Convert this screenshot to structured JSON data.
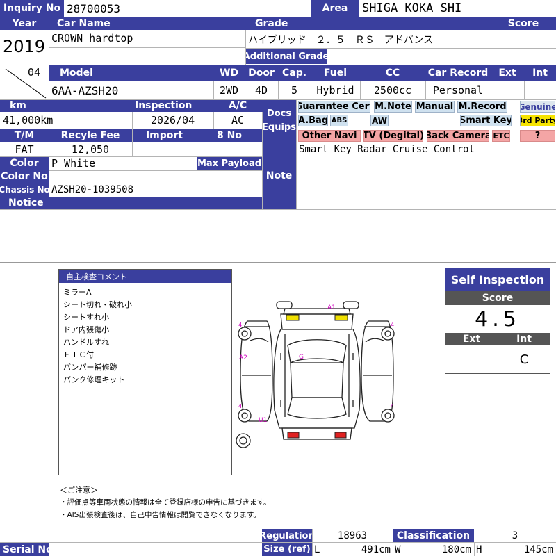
{
  "header": {
    "inquiry_no_label": "Inquiry No",
    "inquiry_no": "28700053",
    "area_label": "Area",
    "area": "SHIGA KOKA SHI"
  },
  "car": {
    "year_label": "Year",
    "year": "2019",
    "month": "04",
    "car_name_label": "Car Name",
    "car_name": "CROWN hardtop",
    "grade_label": "Grade",
    "grade": "ハイブリッド　２．５　ＲＳ　アドバンス",
    "additional_grade_label": "Additional Grade",
    "additional_grade": "",
    "score_label": "Score",
    "score": ""
  },
  "model_row": {
    "labels": {
      "model": "Model",
      "wd": "WD",
      "door": "Door",
      "cap": "Cap.",
      "fuel": "Fuel",
      "cc": "CC",
      "car_record": "Car Record",
      "ext": "Ext",
      "int": "Int"
    },
    "model": "6AA-AZSH20",
    "wd": "2WD",
    "door": "4D",
    "cap": "5",
    "fuel": "Hybrid",
    "cc": "2500cc",
    "car_record": "Personal",
    "ext": "",
    "int": ""
  },
  "details": {
    "km_label": "km",
    "km": "41,000km",
    "inspection_label": "Inspection",
    "inspection": "2026/04",
    "ac_label": "A/C",
    "ac": "AC",
    "tm_label": "T/M",
    "tm": "FAT",
    "recycle_fee_label": "Recyle Fee",
    "recycle_fee": "12,050",
    "import_label": "Import",
    "import": "",
    "eight_no_label": "8 No",
    "eight_no": "",
    "color_label": "Color",
    "color": "P White",
    "max_payload_label": "Max Payload",
    "max_payload": "",
    "color_no_label": "Color No",
    "color_no": "",
    "chassis_no_label": "Chassis No",
    "chassis_no": "AZSH20-1039508",
    "notice_label": "Notice",
    "notice": ""
  },
  "docs_equips": {
    "label_line1": "Docs",
    "label_line2": "Equips",
    "guarantee_cert": "Guarantee Cert",
    "m_note": "M.Note",
    "manual": "Manual",
    "m_record": "M.Record",
    "genuine": "Genuine",
    "a_bag": "A.Bag",
    "abs": "ABS",
    "aw": "AW",
    "smart_key": "Smart Key",
    "third_party": "3rd Party",
    "other_navi": "Other Navi",
    "tv_digital": "TV (Degital)",
    "back_camera": "Back Camera",
    "etc": "ETC",
    "question": "?"
  },
  "note": {
    "label": "Note",
    "text": "Smart Key Radar Cruise Control"
  },
  "comments": {
    "title": "自主検査コメント",
    "items": [
      "ミラーA",
      "シート切れ・破れ小",
      "シートすれ小",
      "ドア内張傷小",
      "ハンドルすれ",
      "ＥＴＣ付",
      "バンパー補修跡",
      "パンク修理キット"
    ]
  },
  "diagram": {
    "marks": {
      "a1": "A1",
      "a2": "A2",
      "g": "G",
      "u1": "U1",
      "four": "4"
    },
    "colors": {
      "panel": "#f0e000",
      "lamp": "#e02020",
      "mark": "#d000c0"
    }
  },
  "self_inspection": {
    "title": "Self Inspection",
    "score_label": "Score",
    "score": "4.5",
    "ext_label": "Ext",
    "int_label": "Int",
    "ext": "",
    "int": "C"
  },
  "caution": {
    "title": "＜ご注意＞",
    "line1": "・評価点等車両状態の情報は全て登録店様の申告に基づきます。",
    "line2": "・AIS出張検査後は、自己申告情報は閲覧できなくなります。"
  },
  "footer": {
    "serial_no_label": "Serial No",
    "serial_no": "",
    "regulation_label": "Regulation",
    "regulation": "18963",
    "classification_label": "Classification",
    "classification": "3",
    "size_label": "Size (ref)",
    "l_label": "L",
    "l": "491cm",
    "w_label": "W",
    "w": "180cm",
    "h_label": "H",
    "h": "145cm"
  },
  "colors": {
    "header_bg": "#3a3f9e",
    "header_text": "#ffffff"
  }
}
